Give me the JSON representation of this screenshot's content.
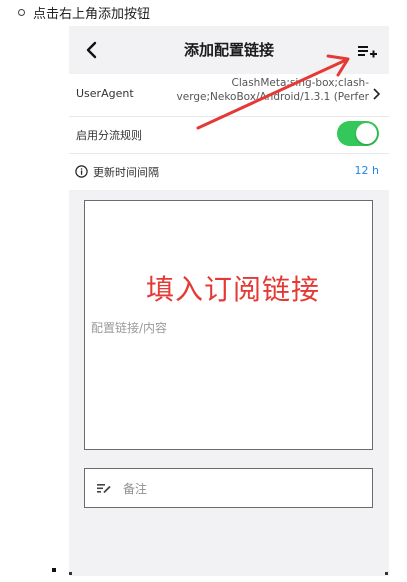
{
  "instruction": "点击右上角添加按钮",
  "nav": {
    "title": "添加配置链接"
  },
  "user_agent": {
    "label": "UserAgent",
    "value": "ClashMeta;sing-box;clash-verge;NekoBox/Android/1.3.1 (Perfer"
  },
  "split_rules": {
    "label": "启用分流规则",
    "enabled": true
  },
  "update_interval": {
    "label": "更新时间间隔",
    "value": "12 h"
  },
  "config_input": {
    "placeholder": "配置链接/内容"
  },
  "remark_input": {
    "placeholder": "备注"
  },
  "annotation": {
    "text": "填入订阅链接"
  },
  "colors": {
    "accent_green": "#34c759",
    "link_blue": "#1e88e5",
    "annotation_red": "#e53935"
  },
  "icons": [
    "chevron-left-icon",
    "playlist-add-icon",
    "chevron-right-icon",
    "info-icon",
    "notes-icon",
    "red-arrow-annotation"
  ]
}
